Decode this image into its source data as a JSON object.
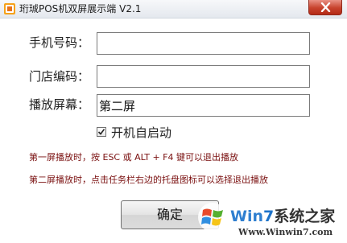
{
  "window": {
    "title": "珩珹POS机双屏展示端 V2.1",
    "close_label": "close"
  },
  "form": {
    "phone_label": "手机号码：",
    "phone_value": "",
    "store_label": "门店编码：",
    "store_value": "",
    "screen_label": "播放屏幕：",
    "screen_value": "第二屏",
    "autostart_label": "开机自启动",
    "autostart_checked": true
  },
  "hints": {
    "line1": "第一屏播放时，按 ESC 或 ALT + F4 键可以退出播放",
    "line2": "第二屏播放时，点击任务栏右边的托盘图标可以选择退出播放"
  },
  "ok_button": {
    "label": "确定"
  },
  "watermark": {
    "brand_part1": "Win",
    "brand_part2": "7",
    "brand_part3": "系统之家",
    "url": "Www.Winwin7.com"
  },
  "icons": [
    "app-icon",
    "close-icon",
    "checkmark-icon",
    "windows-logo-icon"
  ]
}
